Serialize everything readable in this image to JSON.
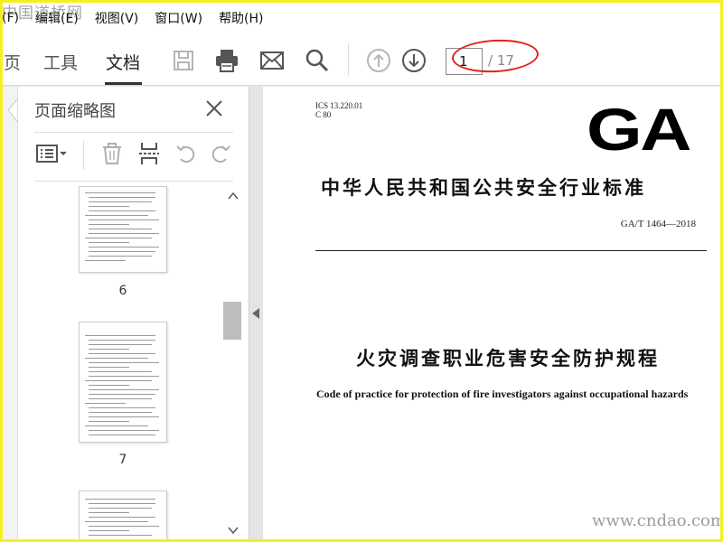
{
  "watermarks": {
    "top": "中国道桥网",
    "bottom": "www.cndao.com"
  },
  "menu": [
    "(F)",
    "编辑(E)",
    "视图(V)",
    "窗口(W)",
    "帮助(H)"
  ],
  "tabs": {
    "home": "页",
    "tools": "工具",
    "document": "文档"
  },
  "page_nav": {
    "current": "1",
    "total": "/ 17"
  },
  "panel": {
    "title": "页面缩略图"
  },
  "thumbnails": [
    {
      "label": "6"
    },
    {
      "label": "7"
    }
  ],
  "document": {
    "ics_line1": "ICS 13.220.01",
    "ics_line2": "C 80",
    "logo": "GA",
    "standard_title": "中华人民共和国公共安全行业标准",
    "standard_code": "GA/T 1464—2018",
    "title_cn": "火灾调查职业危害安全防护规程",
    "title_en": "Code of practice for protection of fire investigators against occupational hazards"
  },
  "colors": {
    "annotation_red": "#e0231c",
    "frame_yellow": "#f5ef22"
  }
}
